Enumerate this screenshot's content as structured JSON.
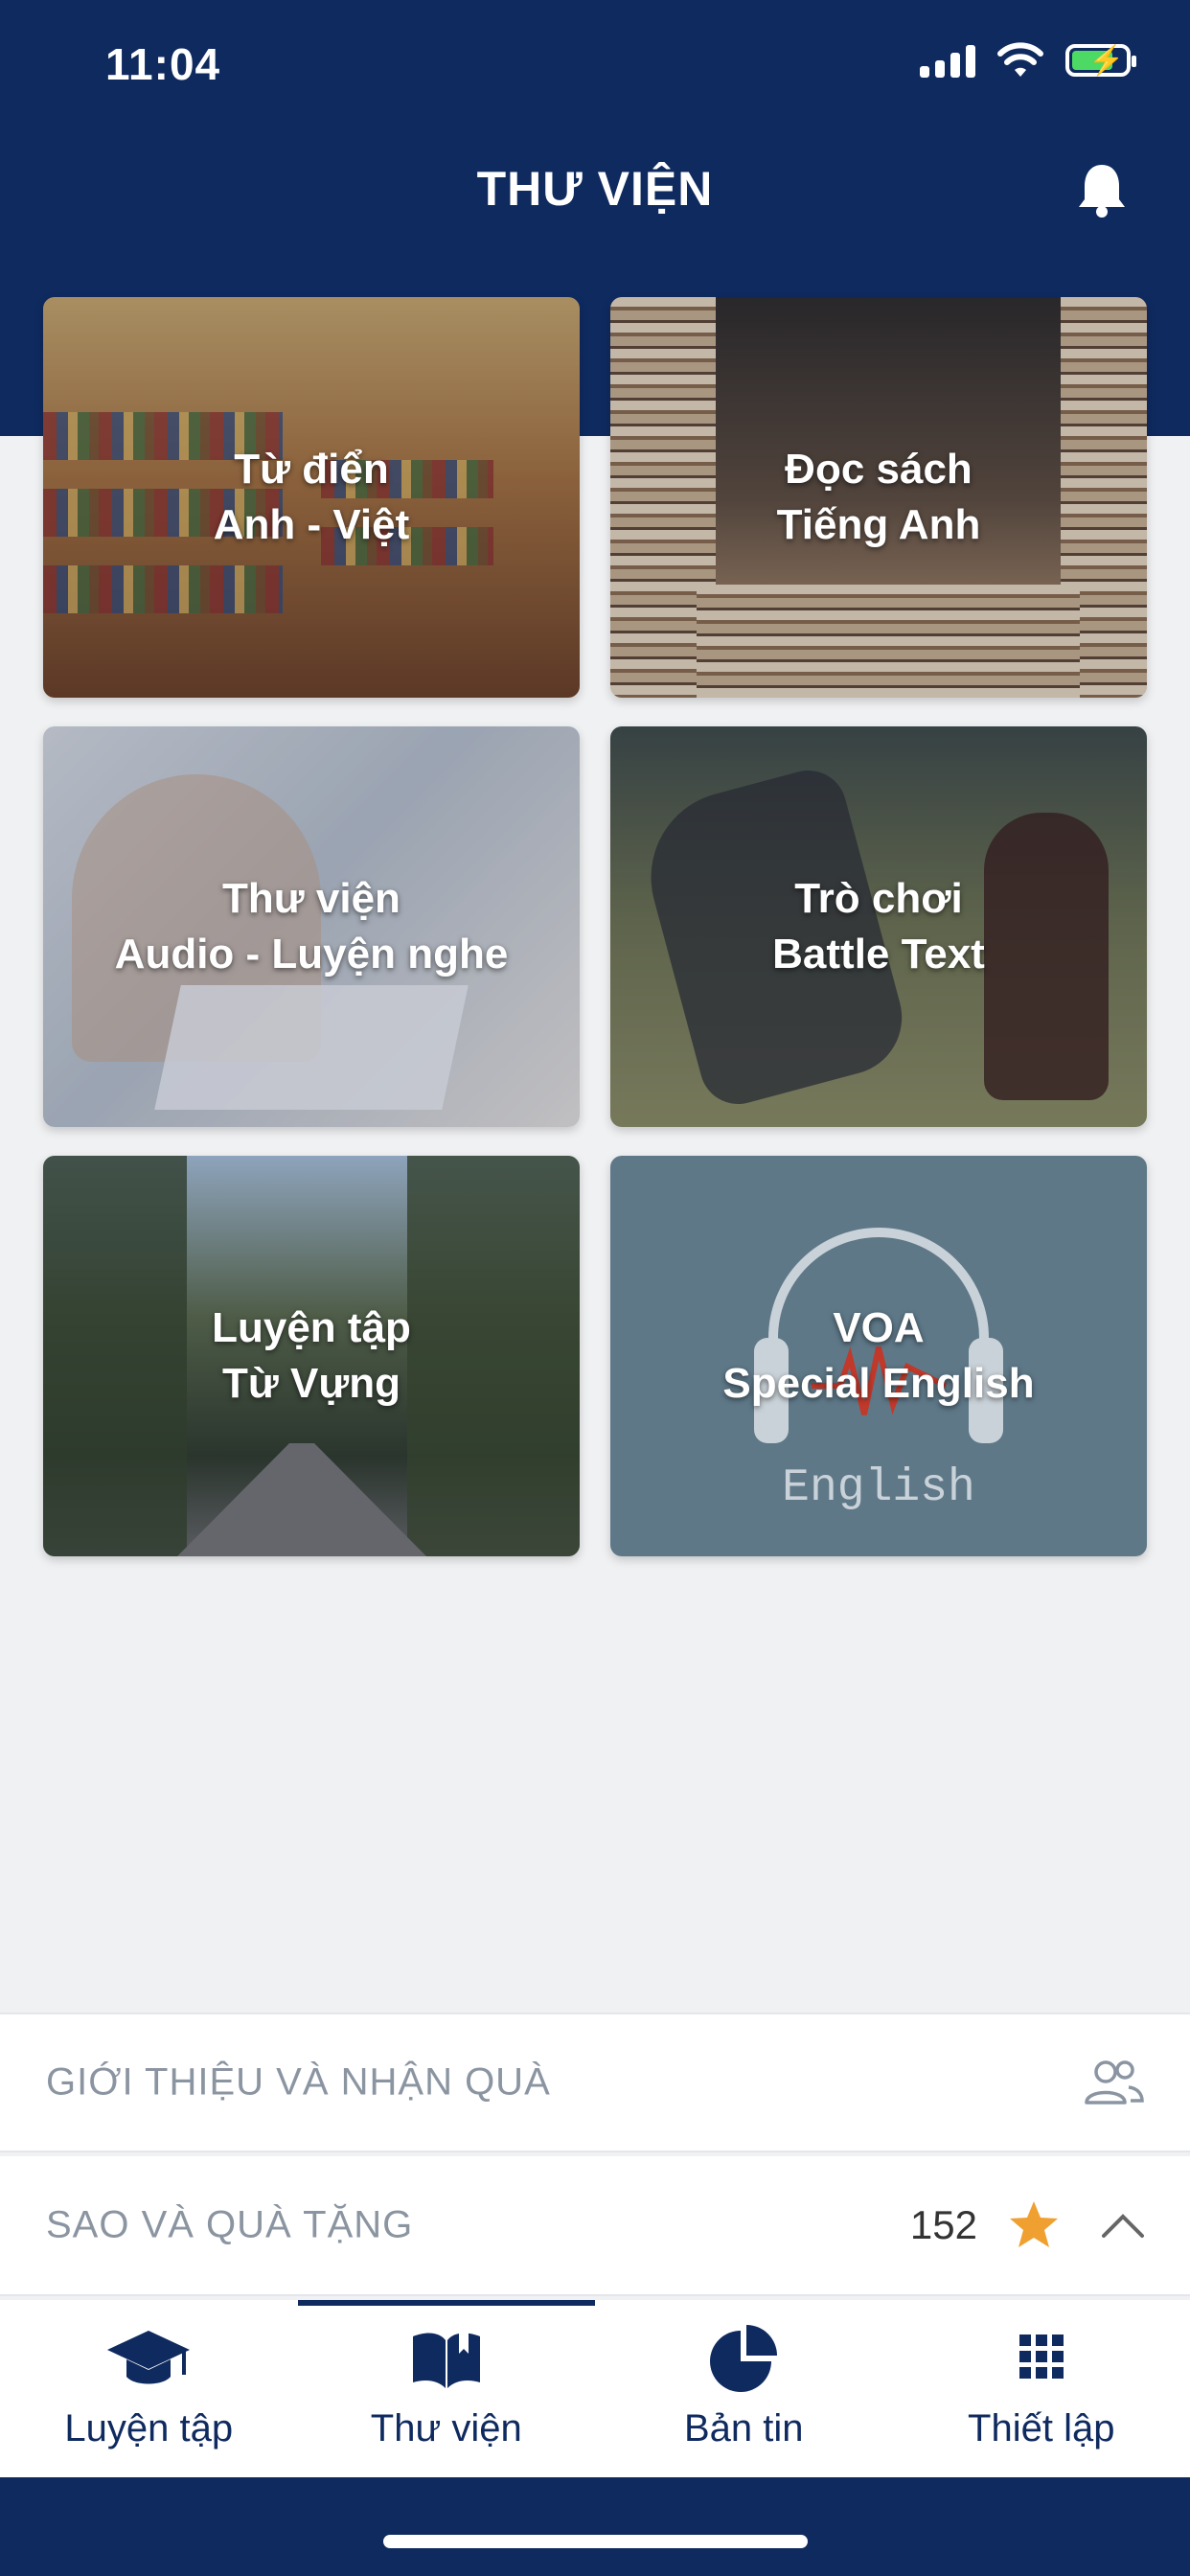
{
  "status_bar": {
    "time": "11:04"
  },
  "header": {
    "title": "THƯ VIỆN"
  },
  "cards": [
    {
      "label": "Từ điển\nAnh - Việt"
    },
    {
      "label": "Đọc sách\nTiếng Anh"
    },
    {
      "label": "Thư viện\nAudio - Luyện nghe"
    },
    {
      "label": "Trò chơi\nBattle Text"
    },
    {
      "label": "Luyện tập\nTừ Vựng"
    },
    {
      "label": "VOA\nSpecial English",
      "logo_text": "English"
    }
  ],
  "panels": {
    "invite": {
      "label": "GIỚI THIỆU VÀ NHẬN QUÀ"
    },
    "stars": {
      "label": "SAO VÀ QUÀ TẶNG",
      "count": "152"
    }
  },
  "tabs": [
    {
      "label": "Luyện tập",
      "icon": "graduation-cap-icon",
      "active": false
    },
    {
      "label": "Thư viện",
      "icon": "open-book-icon",
      "active": true
    },
    {
      "label": "Bản tin",
      "icon": "pie-chart-icon",
      "active": false
    },
    {
      "label": "Thiết lập",
      "icon": "grid-icon",
      "active": false
    }
  ],
  "colors": {
    "primary": "#0f2a5f",
    "star": "#f0a030",
    "voa_card": "#5e7888"
  }
}
